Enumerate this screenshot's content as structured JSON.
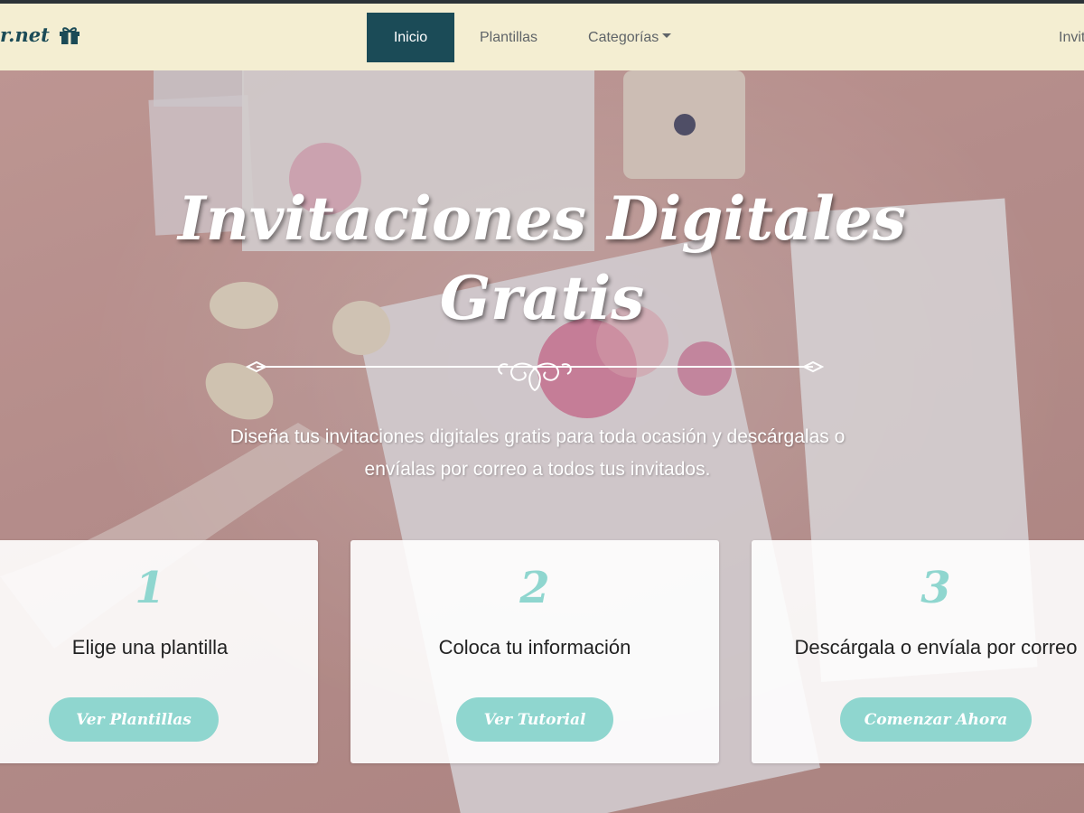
{
  "navbar": {
    "brand_text": "r.net",
    "brand_icon": "gift-icon",
    "items": [
      {
        "label": "Inicio",
        "active": true
      },
      {
        "label": "Plantillas",
        "active": false
      },
      {
        "label": "Categorías",
        "active": false,
        "dropdown": true
      }
    ],
    "right_item": "Invit"
  },
  "hero": {
    "title_line1": "Invitaciones Digitales",
    "title_line2": "Gratis",
    "subtitle_line1": "Diseña tus invitaciones digitales gratis para toda ocasión y descárgalas o",
    "subtitle_line2": "envíalas por correo a todos tus invitados."
  },
  "steps": [
    {
      "number": "1",
      "text": "Elige una plantilla",
      "button": "Ver Plantillas"
    },
    {
      "number": "2",
      "text": "Coloca tu información",
      "button": "Ver Tutorial"
    },
    {
      "number": "3",
      "text": "Descárgala o envíala por correo",
      "button": "Comenzar Ahora"
    }
  ],
  "colors": {
    "nav_bg": "#f4eed2",
    "brand": "#1b4b57",
    "accent": "#8fd6cf",
    "hero_bg": "#d4a9a6"
  }
}
